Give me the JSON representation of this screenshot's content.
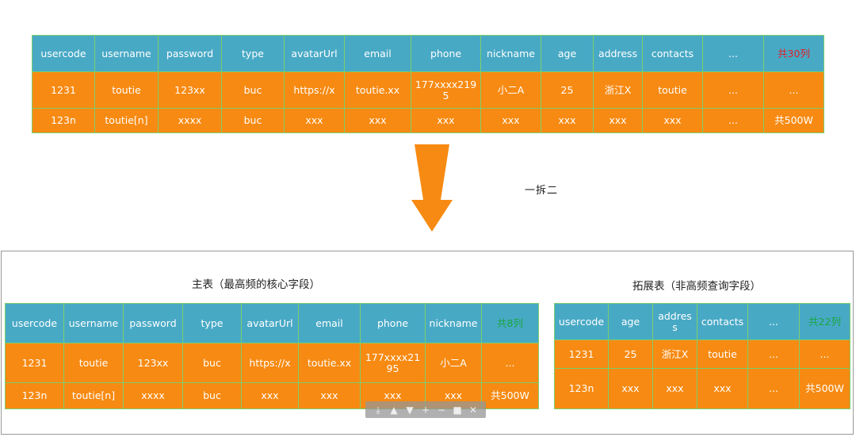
{
  "top_table": {
    "header": [
      "usercode",
      "username",
      "password",
      "type",
      "avatarUrl",
      "email",
      "phone",
      "nickname",
      "age",
      "address",
      "contacts",
      "...",
      "共30列"
    ],
    "rows": [
      [
        "1231",
        "toutie",
        "123xx",
        "buc",
        "https://x",
        "toutie.xx",
        "177xxxx2195",
        "小二A",
        "25",
        "浙江X",
        "toutie",
        "...",
        "..."
      ],
      [
        "123n",
        "toutie[n]",
        "xxxx",
        "buc",
        "xxx",
        "xxx",
        "xxx",
        "xxx",
        "xxx",
        "xxx",
        "xxx",
        "...",
        "共500W"
      ]
    ]
  },
  "split_label": "一拆二",
  "main_table": {
    "title": "主表（最高频的核心字段）",
    "header": [
      "usercode",
      "username",
      "password",
      "type",
      "avatarUrl",
      "email",
      "phone",
      "nickname",
      "共8列"
    ],
    "rows": [
      [
        "1231",
        "toutie",
        "123xx",
        "buc",
        "https://x",
        "toutie.xx",
        "177xxxx2195",
        "小二A",
        "..."
      ],
      [
        "123n",
        "toutie[n]",
        "xxxx",
        "buc",
        "xxx",
        "xxx",
        "xxx",
        "xxx",
        "共500W"
      ]
    ]
  },
  "ext_table": {
    "title": "拓展表（非高频查询字段）",
    "header": [
      "usercode",
      "age",
      "address",
      "contacts",
      "...",
      "共22列"
    ],
    "rows": [
      [
        "1231",
        "25",
        "浙江X",
        "toutie",
        "...",
        "..."
      ],
      [
        "123n",
        "xxx",
        "xxx",
        "xxx",
        "...",
        "共500W"
      ]
    ]
  },
  "toolbar_icons": [
    "download-icon",
    "arrow-up-icon",
    "arrow-down-icon",
    "plus-icon",
    "minus-icon",
    "square-icon",
    "close-icon"
  ],
  "colors": {
    "header_bg": "#48a9c5",
    "row_bg": "#f78a12",
    "grid": "#7ccf6a",
    "arrow": "#f78a12",
    "count_red": "#e0202a",
    "count_green": "#1aa640"
  }
}
